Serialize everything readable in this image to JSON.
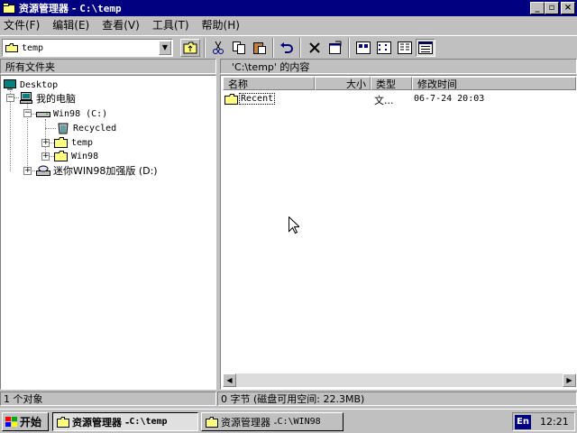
{
  "window": {
    "title_prefix": "资源管理器 - ",
    "title_path": "C:\\temp",
    "buttons": [
      "_",
      "▫",
      "×"
    ]
  },
  "menu": [
    {
      "label": "文件(F)"
    },
    {
      "label": "编辑(E)"
    },
    {
      "label": "查看(V)"
    },
    {
      "label": "工具(T)"
    },
    {
      "label": "帮助(H)"
    }
  ],
  "toolbar": {
    "address_value": "temp",
    "icons": [
      "up-folder-icon",
      "cut-icon",
      "copy-icon",
      "paste-icon",
      "undo-icon",
      "delete-icon",
      "properties-icon",
      "large-icons-view-icon",
      "small-icons-view-icon",
      "list-view-icon",
      "details-view-icon"
    ]
  },
  "left_pane": {
    "header": "所有文件夹",
    "tree": [
      {
        "label": "Desktop"
      },
      {
        "label": "我的电脑"
      },
      {
        "label": "Win98 (C:)"
      },
      {
        "label": "Recycled"
      },
      {
        "label": "temp"
      },
      {
        "label": "Win98"
      },
      {
        "label": "迷你WIN98加强版 (D:)"
      }
    ]
  },
  "right_pane": {
    "header": "'C:\\temp' 的内容",
    "columns": [
      "名称",
      "大小",
      "类型",
      "修改时间"
    ],
    "rows": [
      {
        "name": "Recent",
        "size": "",
        "type": "文...",
        "modified": "06-7-24 20:03"
      }
    ]
  },
  "status": {
    "objects": "1 个对象",
    "info": "0 字节 (磁盘可用空间: 22.3MB)"
  },
  "taskbar": {
    "start_label": "开始",
    "tasks": [
      {
        "prefix": "资源管理器 - ",
        "path": "C:\\temp",
        "active": true
      },
      {
        "prefix": "资源管理器 - ",
        "path": "C:\\WIN98",
        "active": false
      }
    ],
    "ime": "En",
    "clock": "12:21"
  },
  "colors": {
    "title_bar": "#000080",
    "face": "#c0c0c0",
    "folder": "#ffff80"
  }
}
